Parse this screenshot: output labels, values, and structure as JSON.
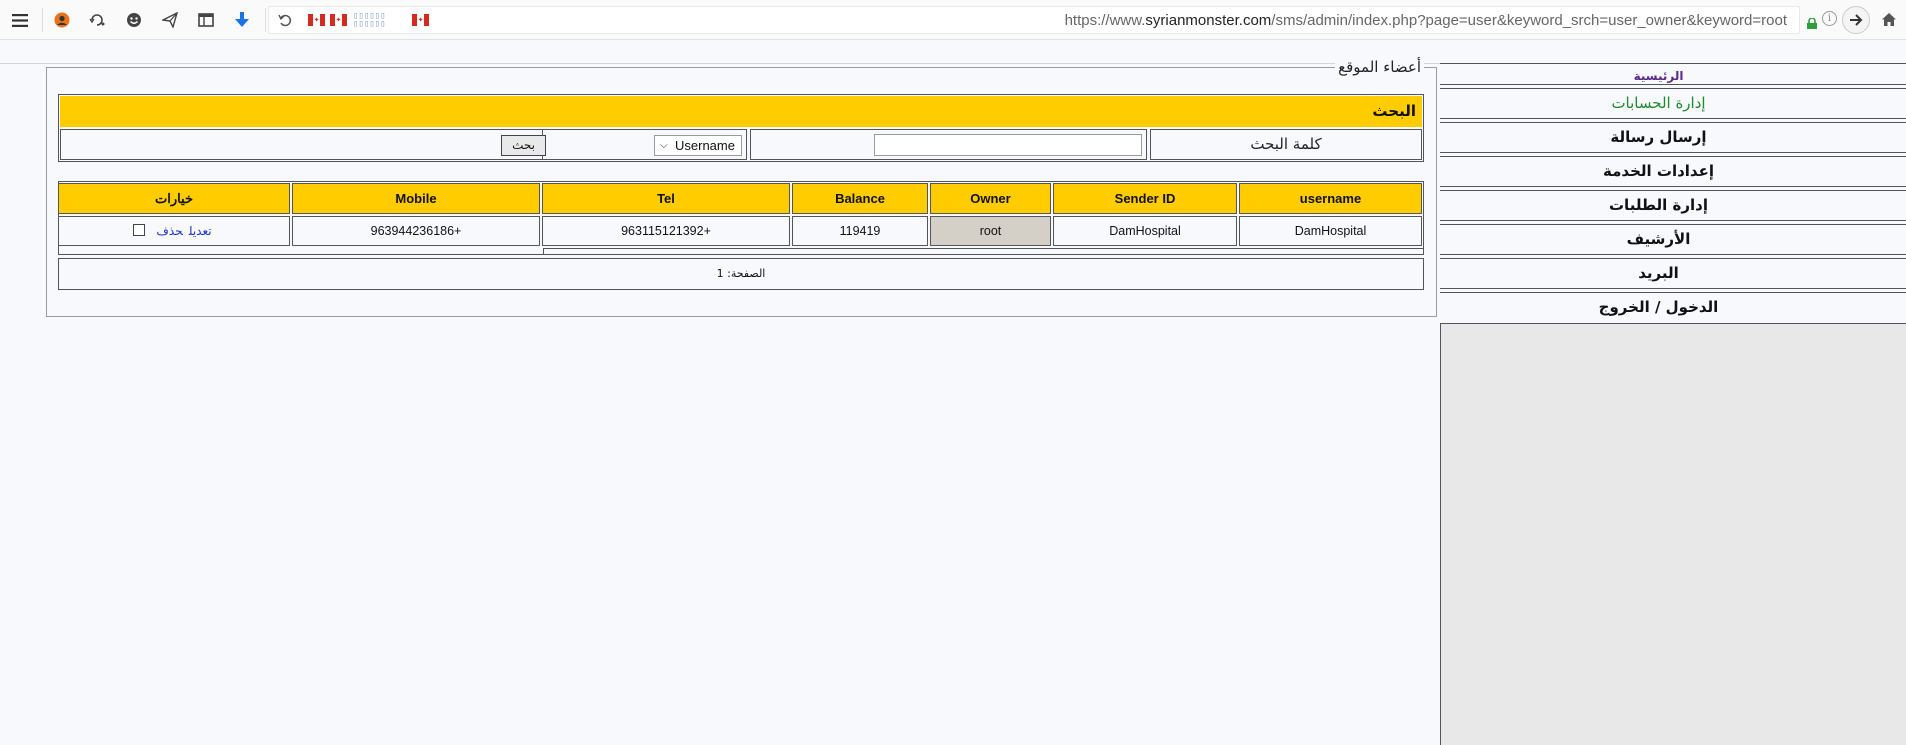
{
  "browser": {
    "url_prefix": "https://www.",
    "url_domain": "syrianmonster.com",
    "url_path": "/sms/admin/index.php?page=user&keyword_srch=user_owner&keyword=root"
  },
  "page": {
    "legend": "أعضاء الموقع",
    "search": {
      "title": "البحث",
      "keyword_label": "كلمة البحث",
      "keyword_value": "",
      "field_selected": "Username",
      "button_label": "بحث"
    },
    "table": {
      "headers": [
        "username",
        "Sender ID",
        "Owner",
        "Balance",
        "Tel",
        "Mobile",
        "خيارات"
      ],
      "rows": [
        {
          "username": "DamHospital",
          "sender_id": "DamHospital",
          "owner": "root",
          "balance": "119419",
          "tel": "963115121392+",
          "mobile": "963944236186+",
          "edit_label": "تعديل",
          "delete_label": "حذف"
        }
      ]
    },
    "pager_label": "الصفحة: 1"
  },
  "menu": {
    "items": [
      "الرئيسية",
      "إدارة الحسابات",
      "إرسال رسالة",
      "إعدادات الخدمة",
      "إدارة الطلبات",
      "الأرشيف",
      "البريد",
      "الدخول / الخروج"
    ],
    "colors": {
      "home": "#5a2a8a",
      "accounts": "#1e8a2e",
      "default": "#111111"
    }
  },
  "colors": {
    "header_bg": "#ffcc00",
    "owner_cell_bg": "#d4d0c8",
    "link": "#1a33c4",
    "page_bg": "#f8f9fd"
  },
  "icons": [
    "menu-icon",
    "avatar-icon",
    "sync-icon",
    "smiley-icon",
    "send-icon",
    "window-icon",
    "download-icon",
    "undo-icon",
    "flag-icon",
    "lock-icon",
    "info-icon",
    "arrow-right-icon",
    "home-icon"
  ]
}
